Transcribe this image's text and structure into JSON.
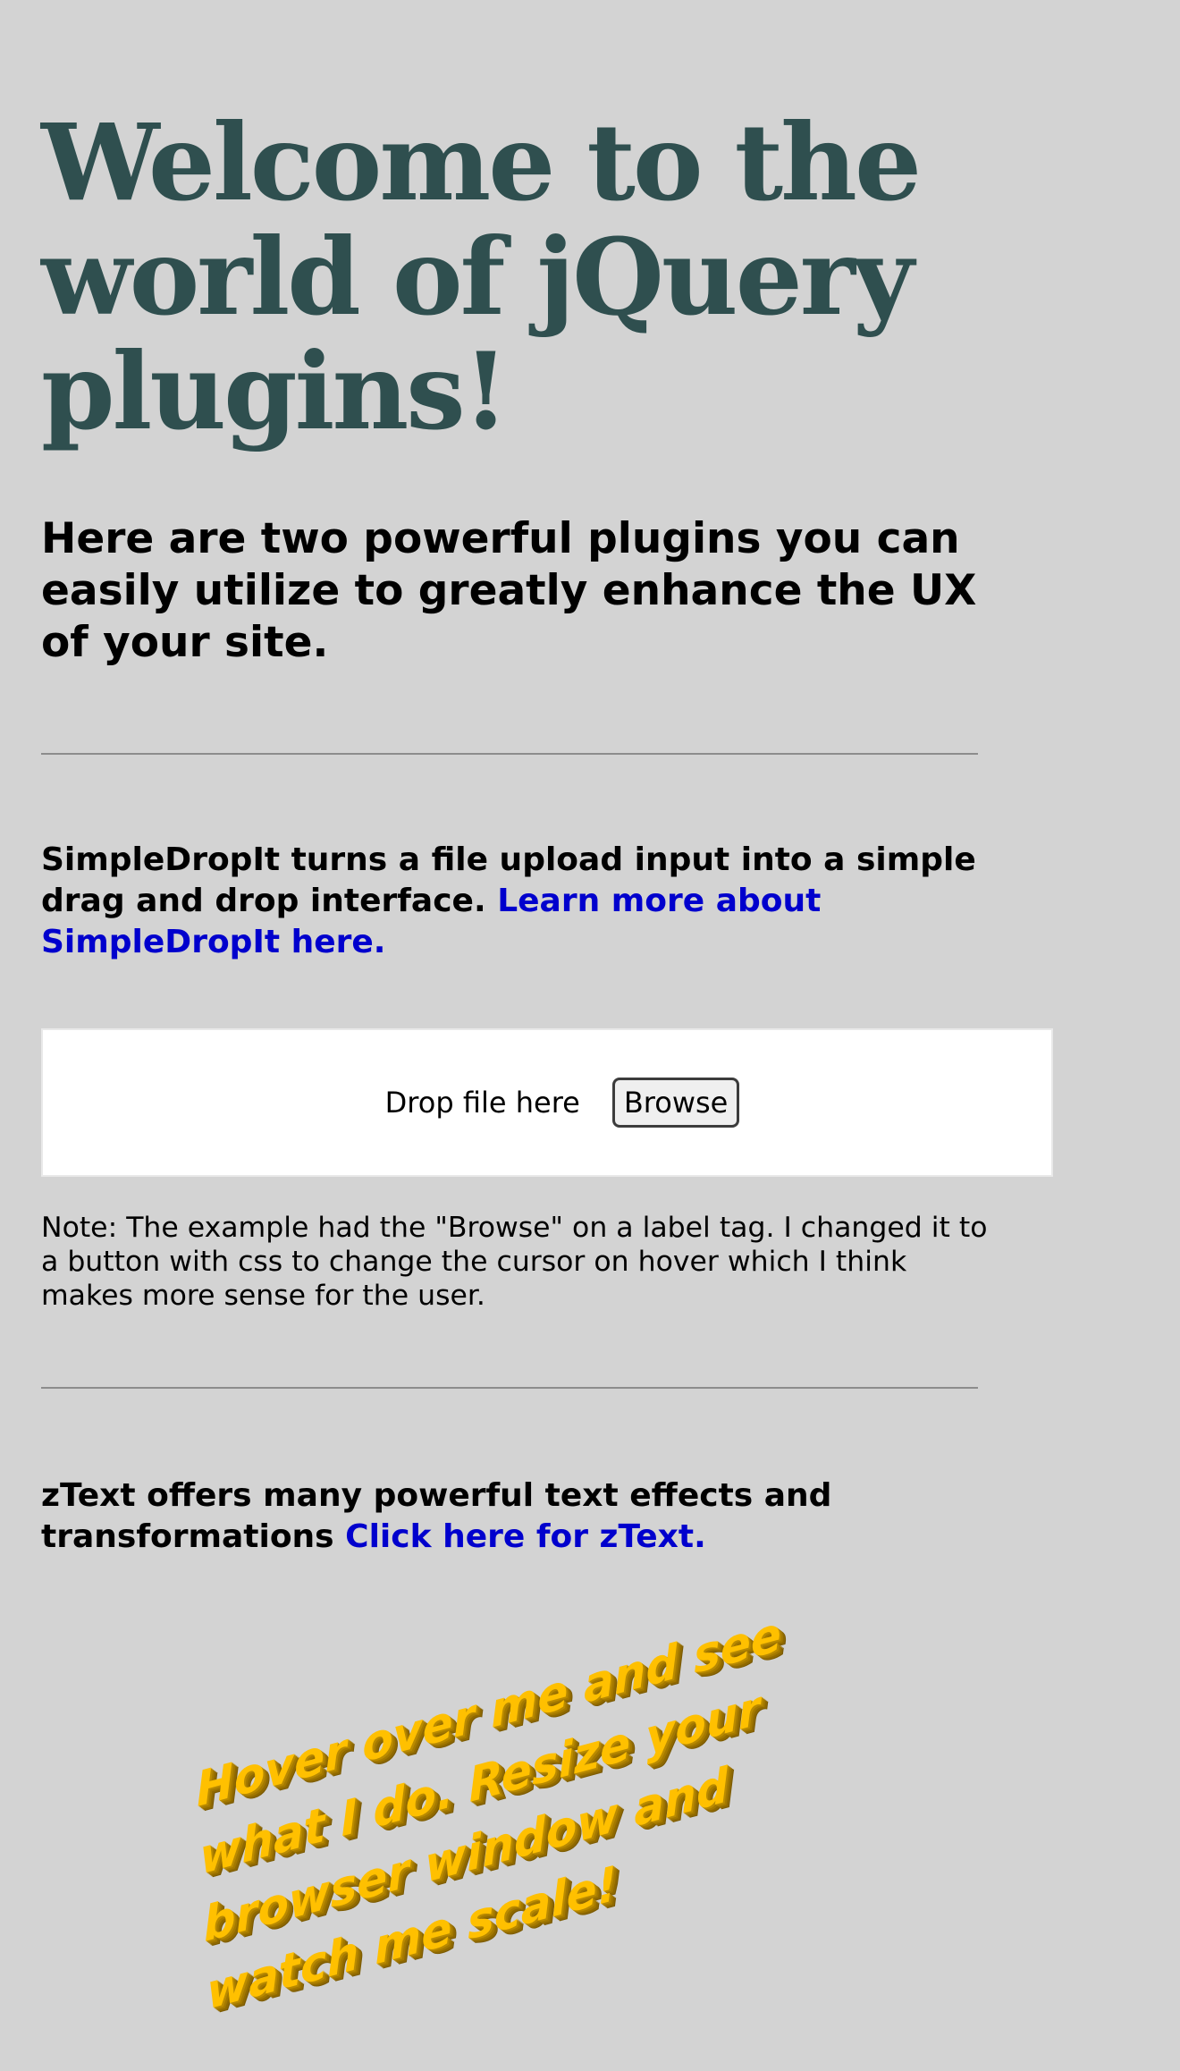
{
  "header": {
    "title": "Welcome to the world of jQuery plugins!",
    "subtitle": "Here are two powerful plugins you can easily utilize to greatly enhance the UX of your site."
  },
  "simpledropit": {
    "intro": "SimpleDropIt turns a file upload input into a simple drag and drop interface.",
    "link_text": "Learn more about SimpleDropIt here.",
    "drop_label": "Drop file here",
    "browse_label": "Browse",
    "note": "Note: The example had the \"Browse\" on a label tag. I changed it to a button with css to change the cursor on hover which I think makes more sense for the user."
  },
  "ztext": {
    "intro": "zText offers many powerful text effects and transformations",
    "link_text": "Click here for zText.",
    "demo_text": "Hover over me and see what I do. Resize your browser window and watch me scale!"
  },
  "colors": {
    "background": "#d3d3d3",
    "title": "#2f4f4f",
    "link": "#0000cd",
    "ztext": "#ffc000"
  }
}
